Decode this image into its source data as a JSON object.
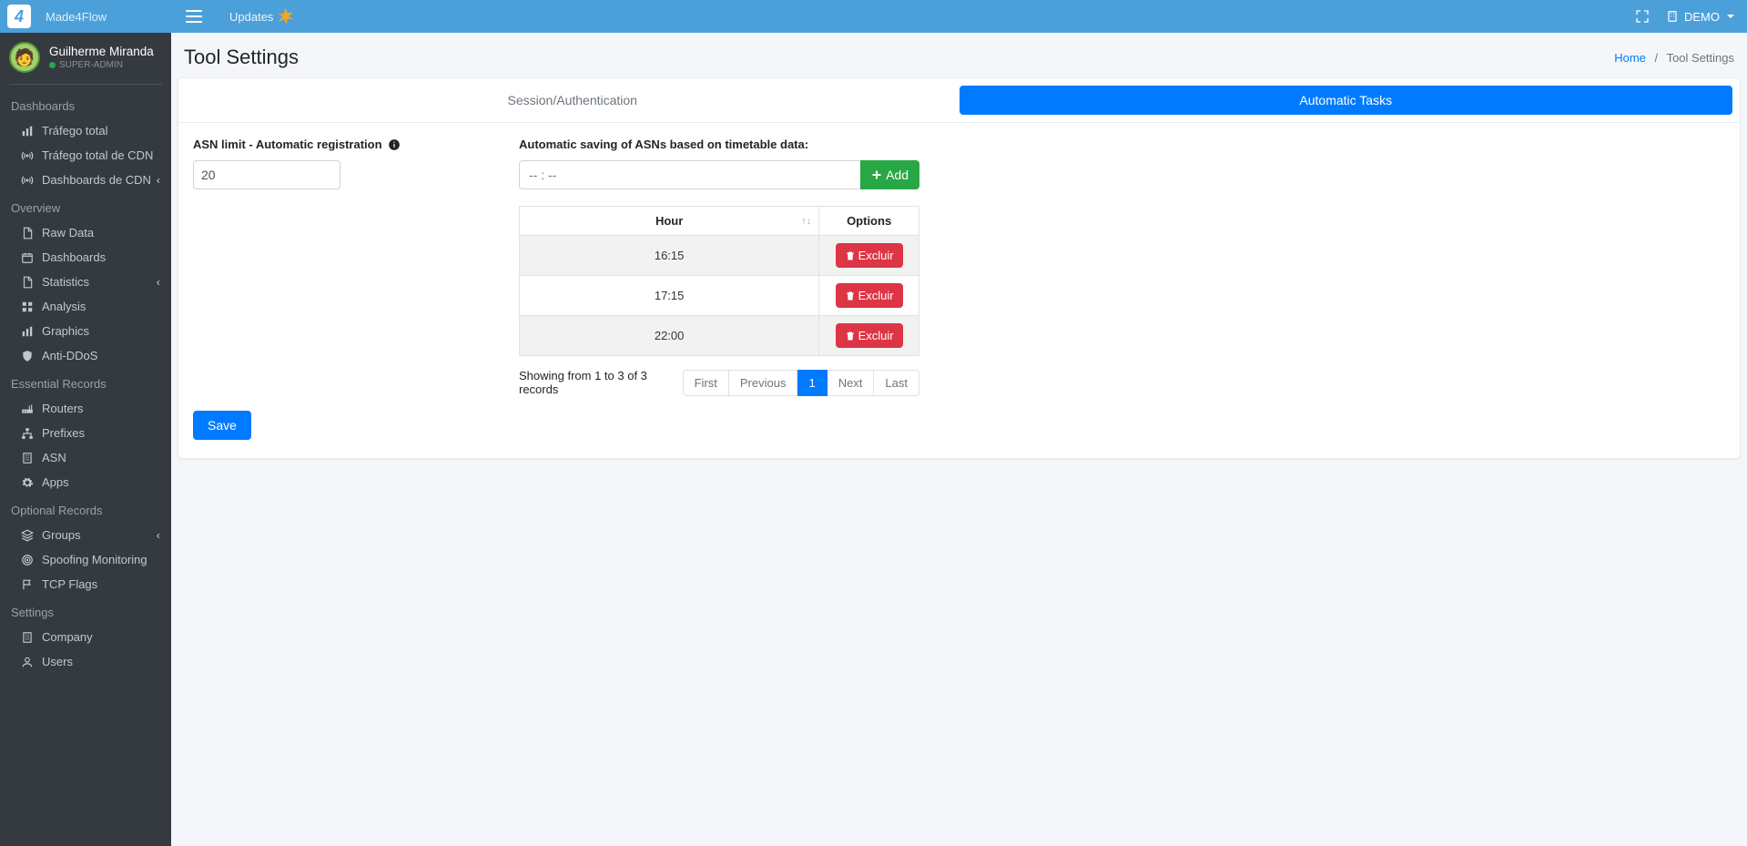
{
  "brand": "Made4Flow",
  "topbar": {
    "updates_label": "Updates",
    "demo_label": "DEMO"
  },
  "user": {
    "name": "Guilherme Miranda",
    "role": "SUPER-ADMIN"
  },
  "sidebar": {
    "sections": [
      {
        "title": "Dashboards",
        "items": [
          {
            "label": "Tráfego total",
            "icon": "chart"
          },
          {
            "label": "Tráfego total de CDN",
            "icon": "antenna"
          },
          {
            "label": "Dashboards de CDN",
            "icon": "antenna",
            "submenu": true
          }
        ]
      },
      {
        "title": "Overview",
        "items": [
          {
            "label": "Raw Data",
            "icon": "file"
          },
          {
            "label": "Dashboards",
            "icon": "calendar"
          },
          {
            "label": "Statistics",
            "icon": "file",
            "submenu": true
          },
          {
            "label": "Analysis",
            "icon": "grid"
          },
          {
            "label": "Graphics",
            "icon": "chart"
          },
          {
            "label": "Anti-DDoS",
            "icon": "shield"
          }
        ]
      },
      {
        "title": "Essential Records",
        "items": [
          {
            "label": "Routers",
            "icon": "router"
          },
          {
            "label": "Prefixes",
            "icon": "sitemap"
          },
          {
            "label": "ASN",
            "icon": "building"
          },
          {
            "label": "Apps",
            "icon": "gear"
          }
        ]
      },
      {
        "title": "Optional Records",
        "items": [
          {
            "label": "Groups",
            "icon": "layers",
            "submenu": true
          },
          {
            "label": "Spoofing Monitoring",
            "icon": "target"
          },
          {
            "label": "TCP Flags",
            "icon": "flag"
          }
        ]
      },
      {
        "title": "Settings",
        "items": [
          {
            "label": "Company",
            "icon": "building"
          },
          {
            "label": "Users",
            "icon": "user"
          }
        ]
      }
    ]
  },
  "page": {
    "title": "Tool Settings",
    "breadcrumb": {
      "home": "Home",
      "current": "Tool Settings"
    },
    "tabs": {
      "session": "Session/Authentication",
      "auto": "Automatic Tasks"
    },
    "asn_limit_label": "ASN limit - Automatic registration",
    "asn_limit_value": "20",
    "auto_save_label": "Automatic saving of ASNs based on timetable data:",
    "time_placeholder": "-- : --",
    "add_label": "Add",
    "table": {
      "col_hour": "Hour",
      "col_options": "Options",
      "rows": [
        {
          "hour": "16:15"
        },
        {
          "hour": "17:15"
        },
        {
          "hour": "22:00"
        }
      ],
      "delete_label": "Excluir"
    },
    "showing": "Showing from 1 to 3 of 3 records",
    "pagination": {
      "first": "First",
      "previous": "Previous",
      "page1": "1",
      "next": "Next",
      "last": "Last"
    },
    "save_label": "Save"
  }
}
